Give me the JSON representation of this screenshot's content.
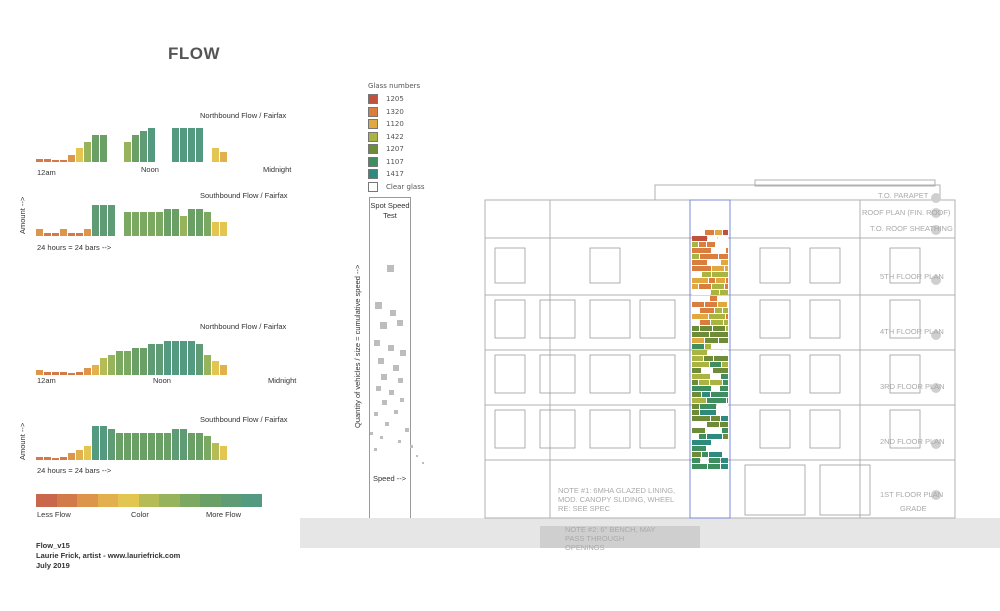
{
  "title": "FLOW",
  "charts": [
    {
      "label": "Northbound Flow / Fairfax",
      "left_tick": "12am",
      "mid_tick": "Noon",
      "right_tick": "Midnight",
      "values": [
        1,
        1,
        0.5,
        0.5,
        2,
        4,
        6,
        8,
        8,
        0,
        0,
        6,
        8,
        9,
        10,
        0,
        0,
        10,
        10,
        10,
        10,
        0,
        4,
        3
      ]
    },
    {
      "label": "Southbound Flow / Fairfax",
      "left_tick": "",
      "mid_tick": "",
      "right_tick": "",
      "values": [
        2,
        1,
        1,
        2,
        1,
        1,
        2,
        9,
        9,
        9,
        0,
        7,
        7,
        7,
        7,
        7,
        8,
        8,
        6,
        8,
        8,
        7,
        4,
        4
      ]
    },
    {
      "label": "Northbound Flow / Fairfax",
      "left_tick": "12am",
      "mid_tick": "Noon",
      "right_tick": "Midnight",
      "values": [
        1.5,
        1,
        1,
        1,
        0.5,
        1,
        2,
        3,
        5,
        6,
        7,
        7,
        8,
        8,
        9,
        9,
        10,
        10,
        10,
        10,
        9,
        6,
        4,
        3
      ]
    },
    {
      "label": "Southbound Flow / Fairfax",
      "left_tick": "",
      "mid_tick": "",
      "right_tick": "",
      "values": [
        1,
        1,
        0.5,
        1,
        2,
        3,
        4,
        10,
        10,
        9,
        8,
        8,
        8,
        8,
        8,
        8,
        8,
        9,
        9,
        8,
        8,
        7,
        5,
        4
      ]
    }
  ],
  "axis": {
    "amount": "Amount -->",
    "hours": "24 hours = 24 bars -->"
  },
  "color_scale": {
    "colors": [
      "#c8674b",
      "#d37a4b",
      "#dd944b",
      "#e2b04c",
      "#e3c551",
      "#b5bc56",
      "#97b35b",
      "#7ba961",
      "#6a9f66",
      "#5f9c75",
      "#549a80"
    ],
    "less": "Less Flow",
    "mid": "Color",
    "more": "More Flow"
  },
  "credit": {
    "line1": "Flow_v15",
    "line2": "Laurie Frick, artist - www.lauriefrick.com",
    "line3": "July 2019"
  },
  "glass_legend": {
    "title": "Glass numbers",
    "items": [
      {
        "color": "#c1503c",
        "label": "1205"
      },
      {
        "color": "#d97e3f",
        "label": "1320"
      },
      {
        "color": "#e0a83f",
        "label": "1120"
      },
      {
        "color": "#a9b540",
        "label": "1422"
      },
      {
        "color": "#6e8b3a",
        "label": "1207"
      },
      {
        "color": "#3f8e60",
        "label": "1107"
      },
      {
        "color": "#2d8a7c",
        "label": "1417"
      },
      {
        "color": "#ffffff",
        "label": "Clear glass"
      }
    ]
  },
  "speed": {
    "title": "Spot Speed Test",
    "ylabel": "Quantity of vehicles / size = cumulative speed -->",
    "xlabel": "Speed -->"
  },
  "building": {
    "levels": [
      "T.O. PARAPET",
      "ROOF PLAN (FIN. ROOF)",
      "T.O. ROOF SHEATHING",
      "5TH FLOOR PLAN",
      "4TH FLOOR PLAN",
      "3RD FLOOR PLAN",
      "2ND FLOOR PLAN",
      "1ST FLOOR PLAN",
      "GRADE"
    ],
    "notes": [
      "NOTE #1: 6MHA GLAZED LINING, MOD. CANOPY SLIDING, WHEEL RE: SEE SPEC",
      "NOTE #2: 6\" BENCH, MAY PASS THROUGH OPENINGS"
    ]
  }
}
